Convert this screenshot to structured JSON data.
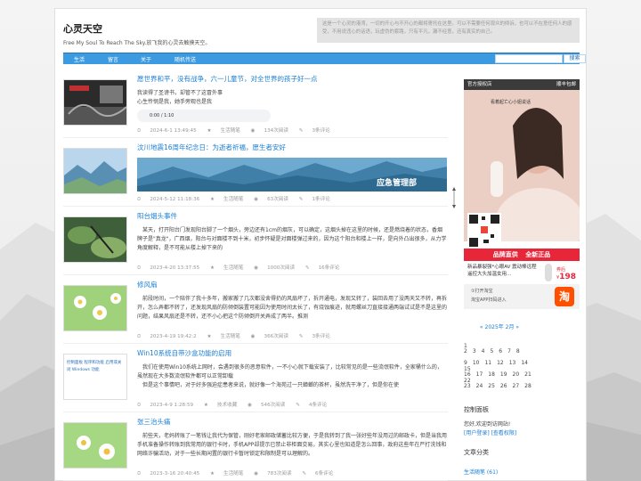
{
  "site": {
    "title": "心灵天空",
    "subtitle": "Free My Soul To Reach The Sky.放飞我的心灵去触摸天空。",
    "notice": "这是一个心灵的港湾，一切的开心与不开心的都将寄托在这里。可以不需要任何观众的倾诉，也可以不在意任何人的感受，不用说违心的话语，玩虚伪的套路，只有平凡，漏不经意，还有真实的自己。"
  },
  "nav": {
    "items": [
      {
        "label": "生活"
      },
      {
        "label": "留言"
      },
      {
        "label": "关于"
      },
      {
        "label": "随机传送"
      }
    ],
    "search_placeholder": "",
    "search_button": "搜索"
  },
  "posts": [
    {
      "title": "愿世界和平，没有战争，六一儿童节，对全世界的孩子好一点",
      "excerpt": "我读得了圣谤书，却管不了这冒外事\n心生怜悯是我，她手旁观也是我",
      "date": "2024-6-1 13:49:45",
      "category": "生活随笔",
      "views": "134次阅读",
      "comments": "3条评论",
      "audio_time": "0:00 / 1:10"
    },
    {
      "title": "汶川地震16周年纪念日：为逝者祈福，愿生者安好",
      "excerpt": "",
      "image_text": "应急管理部",
      "date": "2024-5-12 11:18:36",
      "category": "生活随笔",
      "views": "63次阅读",
      "comments": "1条评论"
    },
    {
      "title": "阳台烟头事件",
      "excerpt": "　某天，打开阳台门发现阳台脚了一个烟头，旁边还有1cm的烟灰，可以确定，这烟头掉在这里的时候，还是燃烧着的状态，香烟牌子是\"真龙\"，广西烟，阳台与对面楼不到十米，初步怀疑是对面楼弹过来的，因为这个阳台和楼上一样，是向外凸出很多，从力学角度解释，是不可能从楼上掉下来的",
      "date": "2023-4-20 13:37:55",
      "category": "生活随笔",
      "views": "1000次阅读",
      "comments": "16条评论"
    },
    {
      "title": "修风扇",
      "excerpt": "　前段时间，一个陪伴了我十多年，搬家搬了几次都没舍得扔的风扇坏了，拆开通电，发现又转了，装回去用了没两天又不转，再拆开，怎么弄都不转了，还发现风扇的防倾倒装置可能因为使用时间太长了，有烧蚀痕迹，就用螺丝刀直接接通两端试试是不是这里的问题，结果风扇还是不转，还不小心把这个防倾倒开关弄成了两半。推测",
      "date": "2023-4-19 19:42:2",
      "category": "生活随笔",
      "views": "366次阅读",
      "comments": "3条评论"
    },
    {
      "title": "Win10系统自带沙盒功能的启用",
      "excerpt": "　我们在使用Win10系统上网时，会遇到很多的恶意软件，一不小心就下载安装了，比较常见的是一些流氓软件，全家桶什么的，虽然现在大多数流氓软件都可以正常卸载\n　但是这个事情吧，对于好多强迫症患者来说，就好像一个海苑过一只蟑螂的茶杯，虽然洗干净了，但是你在使",
      "thumb_text": "控制面板 程序和功能 启用或关闭 Windows 功能",
      "date": "2023-4-9 1:28:59",
      "category": "技术收藏",
      "views": "546次阅读",
      "comments": "4条评论"
    },
    {
      "title": "张三治头痛",
      "excerpt": "　前些天，老妈转账了一笔钱让我代为保管，刚好老家邮政储蓄比较方便，于是我转到了我一张好些年没用过的邮政卡，但是当我用手机准备操作转账到我常用的银行卡时，手机APP却提示已禁止非柜面交易，其实心里也知道是怎么回事，政府这些年在严打洗钱和网络诈骗活动，对于一些长期闲置的银行卡暂时锁定和限制是可以理解的。",
      "date": "2023-3-16 20:40:45",
      "category": "生活随笔",
      "views": "783次阅读",
      "comments": "6条评论"
    }
  ],
  "ad": {
    "shop_label": "官方授权店",
    "brand": "顺丰包邮",
    "slogan": "看着起亡心小姐说话",
    "promo_left": "品牌直供",
    "promo_right": "全新正品",
    "product_desc": "新品暴裂强*心眼AV 震动棒远程遥控大头加温女用...",
    "price_label": "券后",
    "price": "198",
    "price_unit": "¥",
    "footer": "淘宝APP扫码进入",
    "footer2": "①打开淘宝",
    "taobao_glyph": "淘"
  },
  "calendar": {
    "title": "« 2025年 2月 »",
    "rows": [
      "　　　　　　　　　　　　　1",
      "2　3　4　5　6　7　8",
      "9　10　11　12　13　14　15",
      "16　17　18　19　20　21　22",
      "23　24　25　26　27　28"
    ]
  },
  "control_panel": {
    "title": "控制面板",
    "welcome": "您好,欢迎到访网站!",
    "links": "[用户登录] [查看权限]"
  },
  "categories": {
    "title": "文章分类",
    "first": "生活随笔 (61)"
  },
  "colors": {
    "accent": "#3c9be0",
    "link": "#1a7fd5"
  }
}
